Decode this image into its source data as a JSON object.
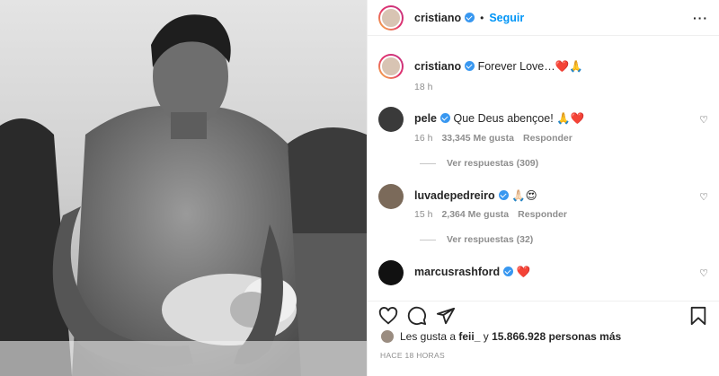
{
  "post": {
    "author": "cristiano",
    "follow_label": "Seguir",
    "more_label": "···"
  },
  "caption": {
    "author": "cristiano",
    "text": "Forever Love…❤️🙏",
    "time": "18 h"
  },
  "comments": [
    {
      "author": "pele",
      "text": "Que Deus abençoe! 🙏❤️",
      "time": "16 h",
      "likes": "33,345 Me gusta",
      "reply_label": "Responder",
      "view_replies": "Ver respuestas (309)"
    },
    {
      "author": "luvadepedreiro",
      "text": "🙏🏻😍",
      "time": "15 h",
      "likes": "2,364 Me gusta",
      "reply_label": "Responder",
      "view_replies": "Ver respuestas (32)"
    },
    {
      "author": "marcusrashford",
      "text": "❤️"
    }
  ],
  "likes_summary": {
    "prefix": "Les gusta a",
    "user": "feii_",
    "joiner": "y",
    "count": "15.866.928 personas más"
  },
  "timestamp": "HACE 18 HORAS",
  "icons": {
    "like": "heart-icon",
    "comment": "comment-icon",
    "share": "share-icon",
    "save": "bookmark-icon",
    "verified": "verified-badge-icon"
  },
  "colors": {
    "accent": "#0095f6",
    "verified": "#3897f0",
    "muted": "#8e8e8e"
  }
}
